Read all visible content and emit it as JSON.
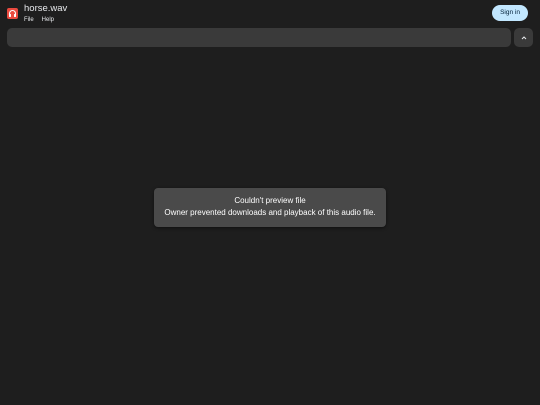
{
  "header": {
    "file_title": "horse.wav",
    "menu": [
      {
        "label": "File"
      },
      {
        "label": "Help"
      }
    ],
    "sign_in_label": "Sign in"
  },
  "toolbar": {
    "collapse_icon": "chevron-up-icon"
  },
  "message": {
    "title": "Couldn't preview file",
    "detail": "Owner prevented downloads and playback of this audio file."
  },
  "colors": {
    "background": "#1e1e1e",
    "app_icon": "#ea4a3f",
    "sign_in_bg": "#c2e7ff",
    "message_bg": "#4a4a4a",
    "toolbar_bg": "#3a3a3a"
  }
}
